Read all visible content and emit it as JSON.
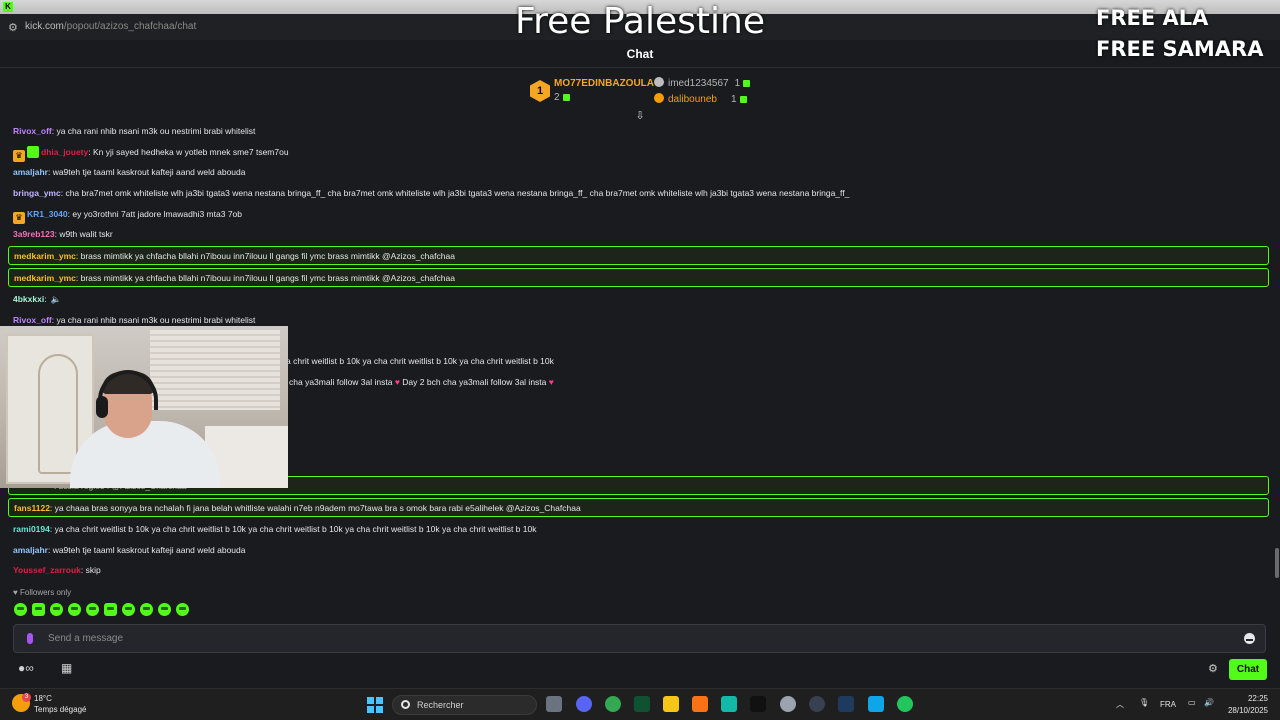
{
  "browser": {
    "url_host": "kick.com",
    "url_path": "/popout/azizos_chafchaa/chat"
  },
  "overlay": {
    "title": "Free Palestine",
    "right_line1": "FREE ALA",
    "right_line2": "FREE SAMARA"
  },
  "chat": {
    "header": "Chat",
    "leaderboard": [
      {
        "rank": "1",
        "name": "MO77EDINBAZOULA",
        "count": "2"
      },
      {
        "name": "imed1234567",
        "count": "1"
      },
      {
        "name": "dalibouneb",
        "count": "1"
      }
    ],
    "messages": [
      {
        "user": "Rivox_off",
        "text": ": ya cha rani nhib nsani m3k ou nestrimi brabi whitelist"
      },
      {
        "user": "dhia_jouety",
        "text": ": Kn yji sayed hedheka w yotleb mnek sme7 tsem7ou"
      },
      {
        "user": "amaljahr",
        "text": ": wa9teh tje taaml kaskrout kafteji aand weld abouda"
      },
      {
        "user": "bringa_ymc",
        "text": ": cha bra7met omk whiteliste wlh ja3bi tgata3 wena nestana bringa_ff_ cha bra7met omk whiteliste wlh ja3bi tgata3 wena nestana bringa_ff_ cha bra7met omk whiteliste wlh ja3bi tgata3 wena nestana bringa_ff_"
      },
      {
        "user": "KR1_3040",
        "text": ": ey yo3rothni 7att jadore lmawadhi3 mta3 7ob"
      },
      {
        "user": "3a9reb123",
        "text": ": w9th walit tskr"
      },
      {
        "user": "medkarim_ymc",
        "text": ": brass mimtikk ya chfacha bllahi n7ibouu inn7ilouu ll gangs fil ymc brass mimtikk @Azizos_chafchaa"
      },
      {
        "user": "medkarim_ymc",
        "text": ": brass mimtikk ya chfacha bllahi n7ibouu inn7ilouu ll gangs fil ymc brass mimtikk @Azizos_chafchaa"
      },
      {
        "user": "4bkxkxi",
        "text": ":"
      },
      {
        "user": "Rivox_off",
        "text": ": ya cha rani nhib nsani m3k ou nestrimi brabi whitelist"
      },
      {
        "user": "",
        "text": "a chrit weitlist b 10k ya cha chrit weitlist b 10k ya cha chrit weitlist b 10k"
      },
      {
        "user": "",
        "text": "cha ya3mali follow 3al insta",
        "text2": "Day 2 bch cha ya3mali follow 3al insta"
      },
      {
        "user": "fans1122",
        "text": ": ya chaaa bras sonyya bra nchalah fi jana belah whitliste walahi n7eb n9adem mo7tawa bra s omok bara rabi e5alihelek @Azizos_Chafchaa"
      },
      {
        "user": "rami0194",
        "text": ": ya cha chrit weitlist b 10k ya cha chrit weitlist b 10k ya cha chrit weitlist b 10k ya cha chrit weitlist b 10k ya cha chrit weitlist b 10k"
      },
      {
        "user": "amaljahr",
        "text": ": wa9teh tje taaml kaskrout kafteji aand weld abouda"
      },
      {
        "user": "Youssef_zarrouk",
        "text": ": skip"
      }
    ],
    "partial_hidden": "f bssla regle3 ! @Azizos_Chafchaa",
    "followers_only": "Followers only",
    "input_placeholder": "Send a message",
    "send_label": "Chat"
  },
  "taskbar": {
    "temp": "18°C",
    "weather": "Temps dégagé",
    "weather_badge": "3",
    "search_placeholder": "Rechercher",
    "lang": "FRA",
    "time": "22:25",
    "date": "28/10/2025"
  },
  "colors": {
    "accent": "#53fc18",
    "gold": "#f5a623"
  }
}
